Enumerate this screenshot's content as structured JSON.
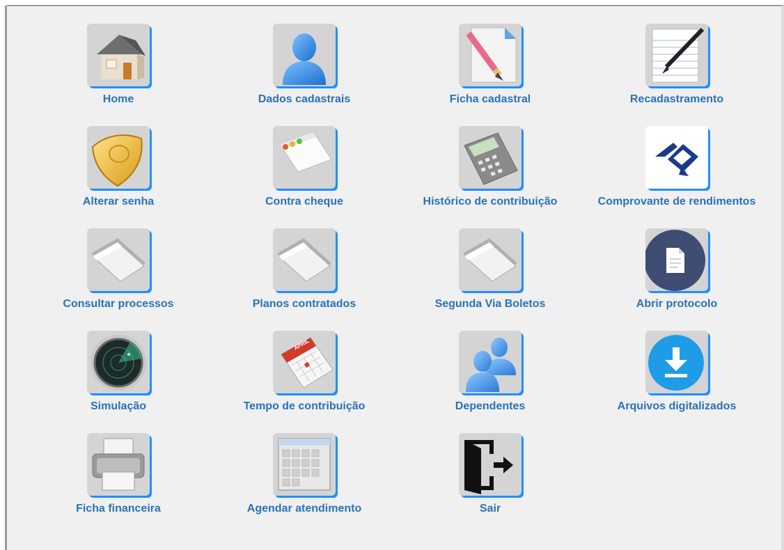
{
  "menu": {
    "home": "Home",
    "dados_cadastrais": "Dados cadastrais",
    "ficha_cadastral": "Ficha cadastral",
    "recadastramento": "Recadastramento",
    "alterar_senha": "Alterar senha",
    "contra_cheque": "Contra cheque",
    "historico_contribuicao": "Histórico de contribuição",
    "comprovante_rendimentos": "Comprovante de rendimentos",
    "consultar_processos": "Consultar processos",
    "planos_contratados": "Planos contratados",
    "segunda_via_boletos": "Segunda Via Boletos",
    "abrir_protocolo": "Abrir protocolo",
    "simulacao": "Simulação",
    "tempo_contribuicao": "Tempo de contribuição",
    "dependentes": "Dependentes",
    "arquivos_digitalizados": "Arquivos digitalizados",
    "ficha_financeira": "Ficha financeira",
    "agendar_atendimento": "Agendar atendimento",
    "sair": "Sair"
  },
  "calendar_icon_text": "APRIL",
  "colors": {
    "label": "#2a72b8",
    "tile_bg": "#d4d4d4",
    "tile_shadow": "#1f8fff",
    "page_bg": "#f0f0f0"
  }
}
